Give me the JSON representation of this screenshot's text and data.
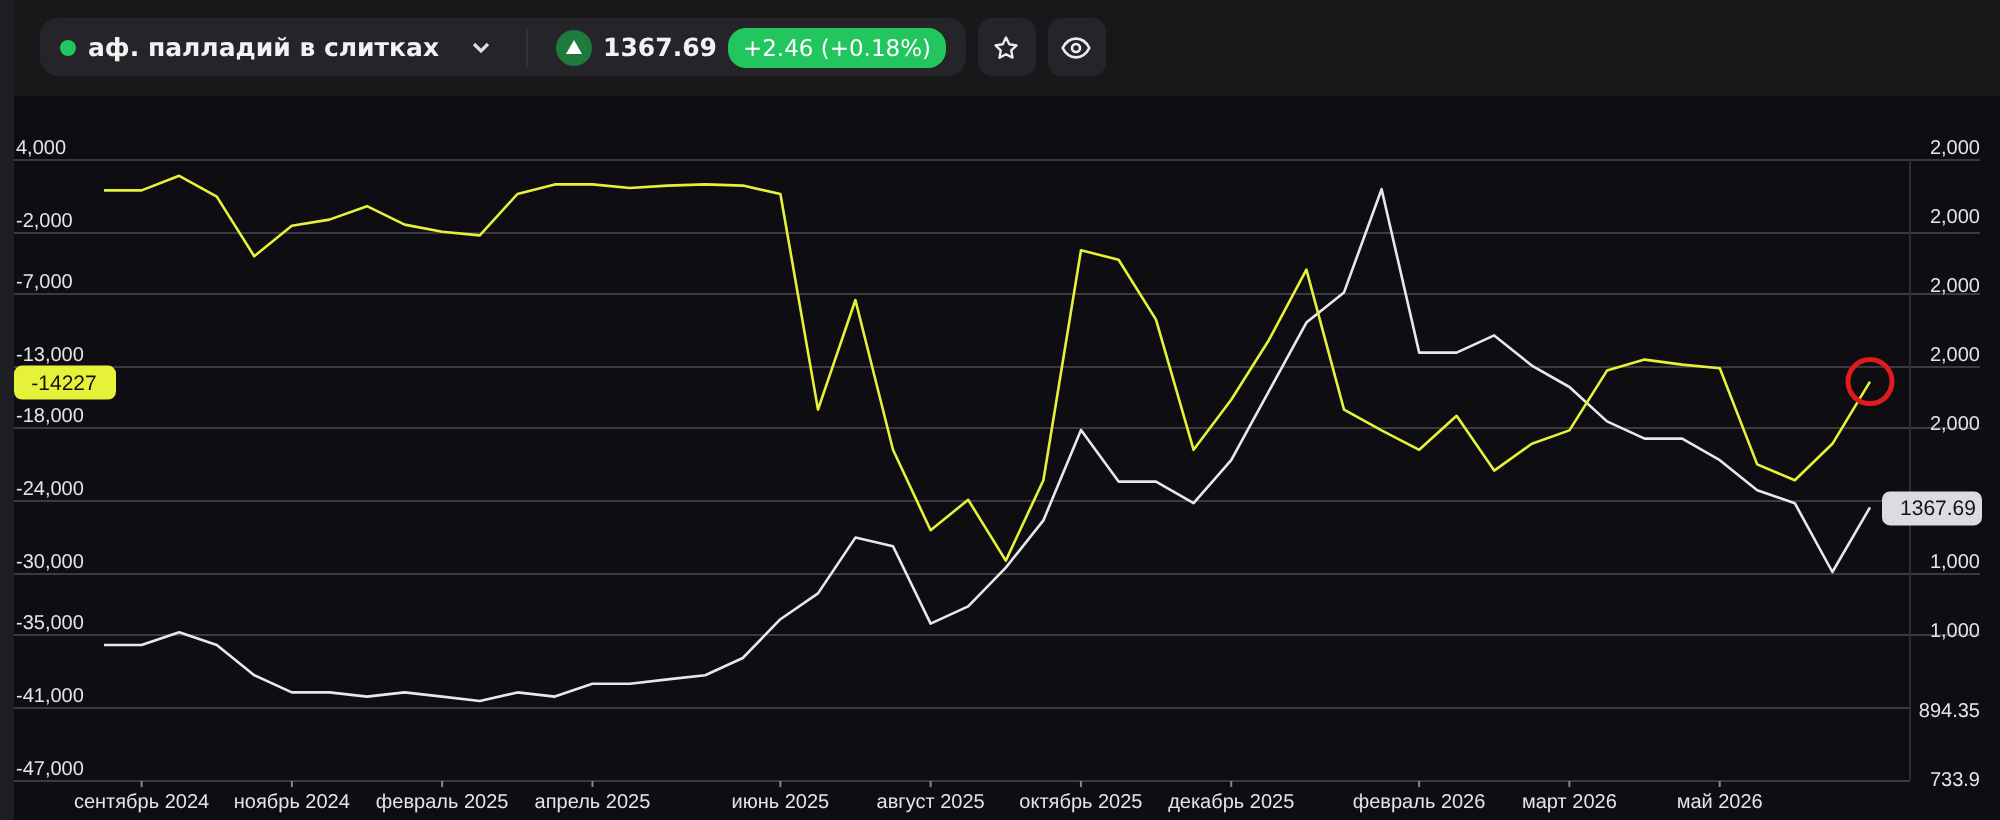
{
  "toolbar": {
    "instrument": {
      "name": "аф. палладий в слитках",
      "live": true
    },
    "rising": true,
    "price": "1367.69",
    "change": "+2.46 (+0.18%)",
    "buttons": [
      {
        "kind": "star"
      },
      {
        "kind": "eye"
      }
    ]
  },
  "chart": {
    "left_tag": "-14227",
    "right_tag": "1367.69",
    "last_point_circled": true,
    "right_axis_labels": [
      "2,000",
      "2,000",
      "2,000",
      "2,000",
      "2,000",
      "1,000",
      "1,000"
    ],
    "chart_data": {
      "type": "line",
      "categories": [
        null,
        "сентябрь 2024",
        null,
        null,
        null,
        "ноябрь 2024",
        null,
        null,
        null,
        "февраль 2025",
        null,
        null,
        null,
        "апрель 2025",
        null,
        null,
        null,
        null,
        "июнь 2025",
        null,
        null,
        null,
        "август 2025",
        null,
        null,
        null,
        "октябрь 2025",
        null,
        null,
        null,
        "декабрь 2025",
        null,
        null,
        null,
        null,
        "февраль 2026",
        null,
        null,
        null,
        "март 2026",
        null,
        null,
        null,
        "май 2026",
        null,
        null,
        null,
        null
      ],
      "series": [
        {
          "color": "#e6f23a",
          "values": [
            1500,
            1500,
            2700,
            1000,
            -3900,
            -1400,
            -900,
            200,
            -1300,
            -1900,
            -2200,
            1200,
            2000,
            2000,
            1700,
            1900,
            2000,
            1900,
            1200,
            -16500,
            -7500,
            -19800,
            -26400,
            -23900,
            -28900,
            -22300,
            -3400,
            -4200,
            -9100,
            -19800,
            -15700,
            -10800,
            -5000,
            -16500,
            -18200,
            -19800,
            -17000,
            -21500,
            -19300,
            -18200,
            -13300,
            -12400,
            -12800,
            -13100,
            -21000,
            -22300,
            -19300,
            -14200
          ]
        },
        {
          "color": "#e8e8ec",
          "axis": "y2",
          "values": [
            1050,
            1050,
            1080,
            1050,
            980,
            940,
            940,
            930,
            940,
            930,
            920,
            940,
            930,
            960,
            960,
            970,
            980,
            1020,
            1110,
            1170,
            1300,
            1280,
            1100,
            1140,
            1230,
            1340,
            1550,
            1430,
            1430,
            1380,
            1480,
            1640,
            1800,
            1870,
            2110,
            1730,
            1730,
            1770,
            1700,
            1650,
            1570,
            1530,
            1530,
            1480,
            1410,
            1380,
            1220,
            1370
          ]
        }
      ],
      "ylim": [
        -47000,
        4000
      ],
      "y2lim": [
        733.9,
        2177.95
      ],
      "y2ticks": [
        {
          "value": 894.35,
          "label": "894.35"
        },
        {
          "value": 733.9,
          "label": "733.9"
        }
      ],
      "grid": true,
      "yticks": [
        {
          "value": 4000,
          "label": "4,000"
        },
        {
          "value": -2000,
          "label": "-2,000"
        },
        {
          "value": -7000,
          "label": "-7,000"
        },
        {
          "value": -13000,
          "label": "-13,000"
        },
        {
          "value": -18000,
          "label": "-18,000"
        },
        {
          "value": -24000,
          "label": "-24,000"
        },
        {
          "value": -30000,
          "label": "-30,000"
        },
        {
          "value": -35000,
          "label": "-35,000"
        },
        {
          "value": -41000,
          "label": "-41,000"
        },
        {
          "value": -47000,
          "label": "-47,000"
        }
      ]
    }
  }
}
